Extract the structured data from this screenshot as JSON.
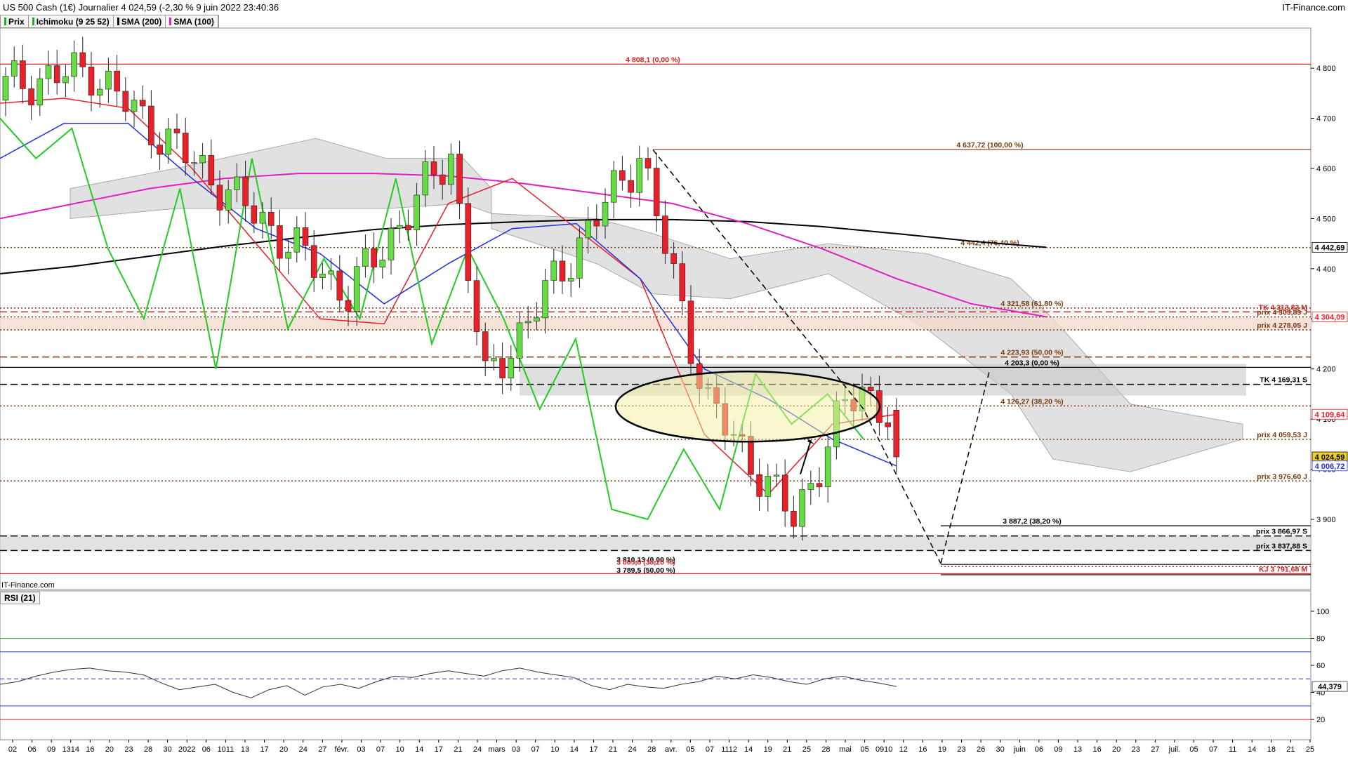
{
  "header": {
    "title": "US 500 Cash (1€) Journalier 4 024,59 (-2,30 % 9 juin 2022 23:40:36",
    "brand": "IT-Finance.com",
    "watermark": "IT-Finance.com"
  },
  "legend": [
    {
      "label": "Prix",
      "color": "#22aa22"
    },
    {
      "label": "Ichimoku (9 25 52)",
      "color": "#22aa22"
    },
    {
      "label": "SMA (200)",
      "color": "#000000"
    },
    {
      "label": "SMA (100)",
      "color": "#e020c0"
    }
  ],
  "rsi_legend": "RSI (21)",
  "colors": {
    "up": "#66dd44",
    "down": "#e8202a",
    "tenkan": "#e8202a",
    "kijun": "#2030e0",
    "chikou": "#22cc22",
    "sma200": "#000000",
    "sma100": "#e020c0",
    "cloud": "#d9d9d9"
  },
  "chart_data": [
    {
      "type": "candlestick",
      "title": "US 500 Cash (1€) Journalier",
      "ylim": [
        3760,
        4880
      ],
      "y_ticks": [
        3900,
        4000,
        4100,
        4200,
        4300,
        4400,
        4500,
        4600,
        4700,
        4800
      ],
      "y_tick_labels": [
        "3 900",
        "4 000",
        "4 100",
        "4 200",
        "4 300",
        "4 400",
        "4 500",
        "4 600",
        "4 700",
        "4 800"
      ],
      "x_tick_labels": [
        "02",
        "06",
        "09",
        "1314",
        "16",
        "20",
        "23",
        "28",
        "30",
        "2022",
        "06",
        "1011",
        "13",
        "17",
        "20",
        "24",
        "27",
        "févr.",
        "03",
        "07",
        "10",
        "14",
        "17",
        "21",
        "24",
        "mars",
        "03",
        "07",
        "10",
        "14",
        "17",
        "21",
        "24",
        "28",
        "avr.",
        "05",
        "07",
        "1112",
        "14",
        "19",
        "21",
        "25",
        "28",
        "mai",
        "05",
        "0910",
        "12",
        "16",
        "19",
        "23",
        "26",
        "30",
        "juin",
        "06",
        "09",
        "13",
        "16",
        "20",
        "23",
        "27",
        "juil.",
        "05",
        "07",
        "11",
        "14",
        "18",
        "21",
        "25"
      ],
      "series": [
        {
          "name": "Prix",
          "kind": "candles",
          "n": 105,
          "key_closes": [
            4766,
            4796,
            4713,
            4349,
            4631,
            4170,
            4630,
            4131,
            3900,
            4125,
            4160,
            4110,
            4024.59
          ],
          "key_index": [
            0,
            10,
            15,
            40,
            52,
            56,
            74,
            82,
            92,
            98,
            100,
            103,
            104
          ]
        },
        {
          "name": "SMA (200)",
          "values": [
            4390,
            4405,
            4425,
            4445,
            4462,
            4478,
            4488,
            4494,
            4498,
            4498,
            4494,
            4484,
            4470,
            4455,
            4442.69
          ]
        },
        {
          "name": "SMA (100)",
          "values": [
            4500,
            4530,
            4560,
            4580,
            4590,
            4590,
            4585,
            4570,
            4550,
            4530,
            4490,
            4440,
            4380,
            4330,
            4304.09
          ]
        },
        {
          "name": "Ichimoku Tenkan",
          "values": [
            4730,
            4740,
            4720,
            4600,
            4450,
            4300,
            4290,
            4530,
            4580,
            4480,
            4380,
            4070,
            3950,
            4090,
            4109.64
          ]
        },
        {
          "name": "Ichimoku Kijun",
          "values": [
            4620,
            4690,
            4690,
            4580,
            4480,
            4430,
            4330,
            4410,
            4480,
            4490,
            4380,
            4200,
            4140,
            4060,
            4006.72
          ]
        }
      ],
      "price_labels": [
        {
          "label": "4 442,69",
          "value": 4442.69
        },
        {
          "label": "4 304,09",
          "value": 4304.09
        },
        {
          "label": "4 109,64",
          "value": 4109.64
        },
        {
          "label": "4 024,59",
          "value": 4024.59
        },
        {
          "label": "4 006,72",
          "value": 4006.72
        }
      ],
      "levels": [
        {
          "label": "4 808,1 (0,00 %)",
          "value": 4808.1,
          "color": "#d02020",
          "style": "solid"
        },
        {
          "label": "4 637,72 (100,00 %)",
          "value": 4637.72,
          "color": "#7a3a10",
          "style": "solid"
        },
        {
          "label": "4 442,4 (76,40 %)",
          "value": 4442.4,
          "color": "#7a3a10",
          "style": "dot"
        },
        {
          "label": "TK 4 313,83 M",
          "value": 4313.83,
          "color": "#d02020",
          "style": "dash"
        },
        {
          "label": "prix 4 303,83 J",
          "value": 4303.83,
          "color": "#7a3a10",
          "style": "dot"
        },
        {
          "label": "4 321,58 (61,80 %)",
          "value": 4321.58,
          "color": "#7a3a10",
          "style": "dot"
        },
        {
          "label": "prix 4 278,05 J",
          "value": 4278.05,
          "color": "#7a3a10",
          "style": "dot"
        },
        {
          "label": "4 223,93 (50,00 %)",
          "value": 4223.93,
          "color": "#7a3a10",
          "style": "dash"
        },
        {
          "label": "4 203,3 (0,00 %)",
          "value": 4203.3,
          "color": "#000000",
          "style": "solid"
        },
        {
          "label": "TK 4 169,31 S",
          "value": 4169.31,
          "color": "#000000",
          "style": "dash"
        },
        {
          "label": "4 126,27 (38,20 %)",
          "value": 4126.27,
          "color": "#7a3a10",
          "style": "dot"
        },
        {
          "label": "prix 4 059,53 J",
          "value": 4059.53,
          "color": "#7a3a10",
          "style": "dot"
        },
        {
          "label": "prix 3 976,60 J",
          "value": 3976.6,
          "color": "#7a3a10",
          "style": "dot"
        },
        {
          "label": "3 887,2 (38,20 %)",
          "value": 3887.2,
          "color": "#000000",
          "style": "solid"
        },
        {
          "label": "prix 3 866,97 S",
          "value": 3866.97,
          "color": "#000000",
          "style": "dash"
        },
        {
          "label": "prix 3 837,88 S",
          "value": 3837.88,
          "color": "#000000",
          "style": "dash"
        },
        {
          "label": "3 810,13 (0,00 %)",
          "value": 3810.13,
          "color": "#000000",
          "style": "solid"
        },
        {
          "label": "3 805,8 (38,20 %)",
          "value": 3805.8,
          "color": "#d02020",
          "style": "dot"
        },
        {
          "label": "3 789,5 (50,00 %)",
          "value": 3789.5,
          "color": "#000000",
          "style": "solid"
        },
        {
          "label": "KJ 3 791,68 M",
          "value": 3791.68,
          "color": "#d02020",
          "style": "solid"
        }
      ]
    },
    {
      "type": "line",
      "title": "RSI (21)",
      "ylim": [
        5,
        115
      ],
      "y_ticks": [
        20,
        40,
        60,
        80,
        100
      ],
      "levels": [
        80,
        70,
        50,
        30,
        20
      ],
      "series": [
        {
          "name": "RSI (21)",
          "last": 44.379,
          "last_label": "44,379",
          "values": [
            46,
            48,
            52,
            55,
            57,
            58,
            56,
            55,
            53,
            47,
            42,
            44,
            46,
            40,
            36,
            42,
            45,
            38,
            44,
            46,
            43,
            48,
            52,
            51,
            54,
            56,
            54,
            52,
            56,
            58,
            55,
            53,
            51,
            45,
            42,
            46,
            44,
            43,
            46,
            48,
            52,
            50,
            53,
            51,
            48,
            46,
            50,
            52,
            49,
            47,
            44.379
          ]
        }
      ]
    }
  ]
}
